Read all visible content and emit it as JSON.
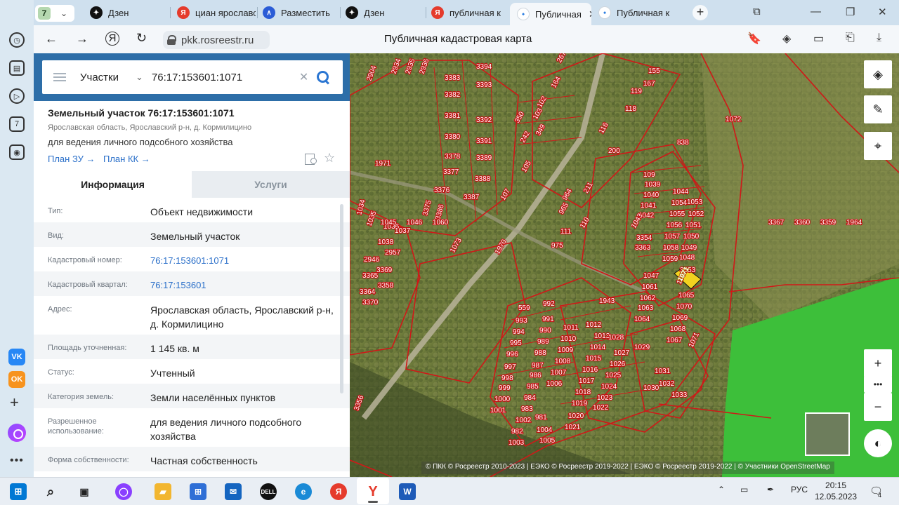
{
  "browser": {
    "tab_count": "7",
    "tabs": [
      {
        "label": "Дзен",
        "icon": "dzen-icon"
      },
      {
        "label": "циан ярославск",
        "icon": "yandex-icon"
      },
      {
        "label": "Разместить",
        "icon": "cian-icon"
      },
      {
        "label": "Дзен",
        "icon": "dzen-icon"
      },
      {
        "label": "публичная к",
        "icon": "yandex-icon"
      },
      {
        "label": "Публичная",
        "icon": "rosreestr-icon",
        "active": true
      },
      {
        "label": "Публичная к",
        "icon": "rosreestr-icon"
      }
    ],
    "url": "pkk.rosreestr.ru",
    "page_title": "Публичная кадастровая карта"
  },
  "search": {
    "type_label": "Участки",
    "query": "76:17:153601:1071"
  },
  "object": {
    "title": "Земельный участок 76:17:153601:1071",
    "address": "Ярославская область, Ярославский р-н, д. Кормилицино",
    "use": "для ведения личного подсобного хозяйства",
    "plan_zu": "План ЗУ →",
    "plan_kk": "План КК →"
  },
  "panel_tabs": {
    "info": "Информация",
    "services": "Услуги"
  },
  "details": [
    {
      "k": "Тип:",
      "v": "Объект недвижимости"
    },
    {
      "k": "Вид:",
      "v": "Земельный участок"
    },
    {
      "k": "Кадастровый номер:",
      "v": "76:17:153601:1071",
      "link": true
    },
    {
      "k": "Кадастровый квартал:",
      "v": "76:17:153601",
      "link": true
    },
    {
      "k": "Адрес:",
      "v": "Ярославская область, Ярославский р-н, д. Кормилицино"
    },
    {
      "k": "Площадь уточненная:",
      "v": "1 145 кв. м"
    },
    {
      "k": "Статус:",
      "v": "Учтенный"
    },
    {
      "k": "Категория земель:",
      "v": "Земли населённых пунктов"
    },
    {
      "k": "Разрешенное использование:",
      "v": "для ведения личного подсобного хозяйства"
    },
    {
      "k": "Форма собственности:",
      "v": "Частная собственность"
    }
  ],
  "map": {
    "parcel_labels": [
      "2904",
      "2934",
      "2935",
      "2936",
      "3383",
      "3394",
      "3382",
      "3393",
      "3381",
      "3392",
      "3380",
      "3391",
      "3378",
      "3389",
      "3377",
      "3388",
      "3376",
      "3387",
      "3386",
      "3375",
      "1971",
      "267",
      "164",
      "155",
      "167",
      "119",
      "118",
      "102",
      "103",
      "350",
      "349",
      "242",
      "116",
      "200",
      "105",
      "107",
      "964",
      "211",
      "965",
      "111",
      "110",
      "975",
      "109",
      "1039",
      "1040",
      "1041",
      "1042",
      "1043",
      "1044",
      "1053",
      "1054",
      "1052",
      "1055",
      "1051",
      "1056",
      "1050",
      "1057",
      "1049",
      "1058",
      "1048",
      "1059",
      "1047",
      "1061",
      "1062",
      "1063",
      "1064",
      "1065",
      "1070",
      "1069",
      "1068",
      "1067",
      "1066",
      "1071",
      "1072",
      "838",
      "1073",
      "1970",
      "1943",
      "559",
      "992",
      "993",
      "991",
      "994",
      "990",
      "995",
      "989",
      "996",
      "988",
      "997",
      "987",
      "998",
      "986",
      "999",
      "985",
      "1000",
      "984",
      "1001",
      "983",
      "1002",
      "982",
      "1003",
      "981",
      "1004",
      "1005",
      "1006",
      "1007",
      "1008",
      "1009",
      "1010",
      "1011",
      "1012",
      "1013",
      "1014",
      "1015",
      "1016",
      "1017",
      "1018",
      "1019",
      "1020",
      "1021",
      "1022",
      "1023",
      "1024",
      "1025",
      "1026",
      "1027",
      "1028",
      "1029",
      "1030",
      "1031",
      "1032",
      "1033",
      "1034",
      "1035",
      "1036",
      "1037",
      "1038",
      "2957",
      "2946",
      "3369",
      "3365",
      "3358",
      "3364",
      "3370",
      "3356",
      "3354",
      "3363",
      "3353",
      "3367",
      "3360",
      "3359",
      "1964",
      "1045",
      "1046",
      "1060"
    ],
    "highlight_label": "1071",
    "attribution": "© ПКК © Росреестр 2010-2023 | ЕЭКО © Росреестр 2019-2022 | ЕЭКО © Росреестр 2019-2022 | © Участники OpenStreetMap",
    "highlight_color": "#f2d21f",
    "boundary_color": "#d01818",
    "forest_color": "#3dbf3a"
  },
  "taskbar": {
    "lang": "РУС",
    "time": "20:15",
    "date": "12.05.2023",
    "notif_count": "4"
  }
}
